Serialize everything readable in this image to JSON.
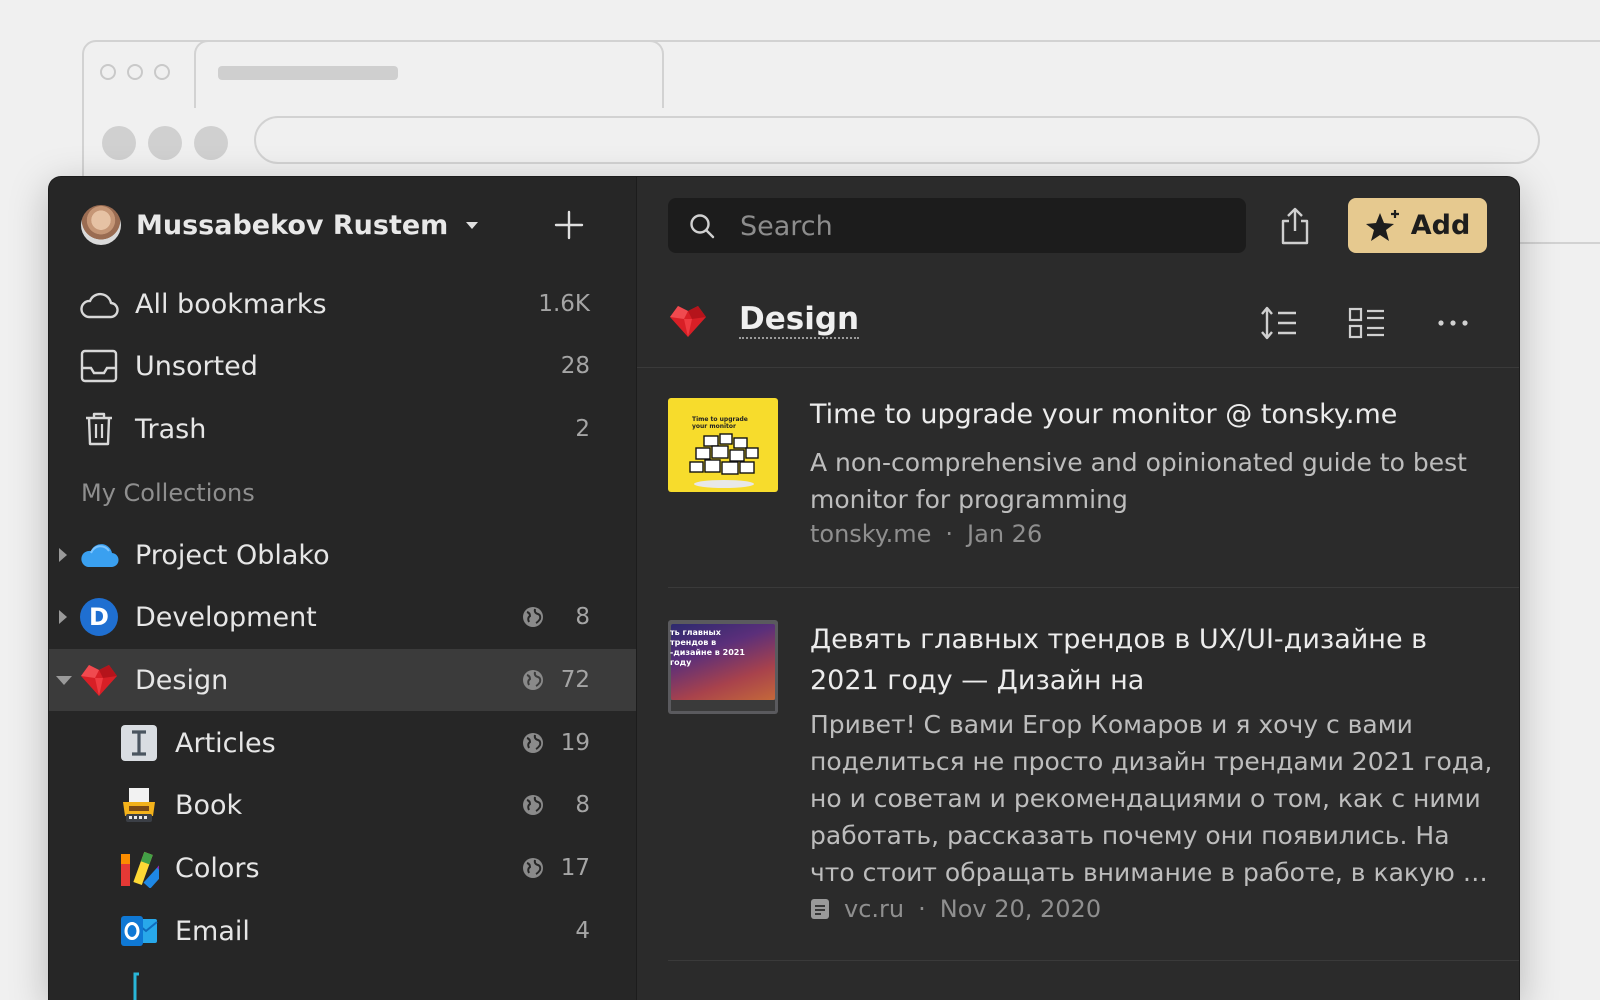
{
  "user": {
    "name": "Mussabekov Rustem"
  },
  "sidebar": {
    "system": [
      {
        "label": "All bookmarks",
        "count": "1.6K",
        "icon": "cloud-icon"
      },
      {
        "label": "Unsorted",
        "count": "28",
        "icon": "inbox-icon"
      },
      {
        "label": "Trash",
        "count": "2",
        "icon": "trash-icon"
      }
    ],
    "section_title": "My Collections",
    "collections": [
      {
        "label": "Project Oblako",
        "count": "",
        "icon": "blue-cloud-icon",
        "expanded": false,
        "public": false
      },
      {
        "label": "Development",
        "count": "8",
        "icon": "d-letter-icon",
        "expanded": false,
        "public": true
      },
      {
        "label": "Design",
        "count": "72",
        "icon": "red-heart-gem-icon",
        "expanded": true,
        "public": true,
        "selected": true
      },
      {
        "label": "Articles",
        "count": "19",
        "icon": "text-cursor-icon",
        "public": true,
        "child": true
      },
      {
        "label": "Book",
        "count": "8",
        "icon": "typewriter-icon",
        "public": true,
        "child": true
      },
      {
        "label": "Colors",
        "count": "17",
        "icon": "color-swatches-icon",
        "public": true,
        "child": true
      },
      {
        "label": "Email",
        "count": "4",
        "icon": "outlook-icon",
        "public": false,
        "child": true
      }
    ]
  },
  "toolbar": {
    "search_placeholder": "Search",
    "add_label": "Add"
  },
  "collection": {
    "title": "Design"
  },
  "items": [
    {
      "title": "Time to upgrade your monitor @ tonsky.me",
      "description": "A non-comprehensive and opinionated guide to best monitor for programming",
      "domain": "tonsky.me",
      "separator": "·",
      "date": "Jan 26",
      "thumb_text": "Time to upgrade your monitor"
    },
    {
      "title": "Девять главных трендов в UX/UI-дизайне в 2021 году — Дизайн на",
      "description": "Привет! С вами Егор Комаров и я хочу с вами поделиться не просто дизайн трендами 2021 года, но и советам и рекомендациями о том, как с ними работать, рассказать почему они появились. На что стоит обращать внимание в работе, в какую …",
      "domain": "vc.ru",
      "separator": "·",
      "date": "Nov 20, 2020",
      "thumb_text": "ть главных трендов в -дизайне в 2021 году"
    }
  ],
  "colors": {
    "accent": "#e6c98f",
    "sidebar_bg": "#262626",
    "main_bg": "#2b2b2b",
    "selected_row": "#3b3b3b"
  }
}
